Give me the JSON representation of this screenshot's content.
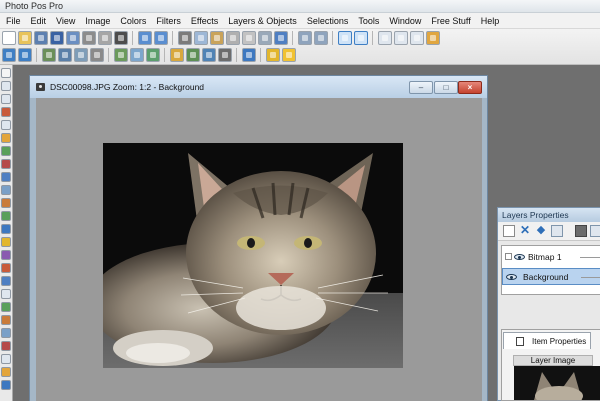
{
  "app": {
    "title": "Photo Pos Pro"
  },
  "menu": [
    "File",
    "Edit",
    "View",
    "Image",
    "Colors",
    "Filters",
    "Effects",
    "Layers & Objects",
    "Selections",
    "Tools",
    "Window",
    "Free Stuff",
    "Help"
  ],
  "document": {
    "title": "DSC00098.JPG  Zoom: 1:2 - Background"
  },
  "window_buttons": {
    "minimize": "–",
    "maximize": "□",
    "close": "×"
  },
  "layers_panel": {
    "title": "Layers Properties",
    "layers": [
      {
        "name": "Bitmap 1",
        "selected": false
      },
      {
        "name": "Background",
        "selected": true
      }
    ],
    "item_properties_tab": "Item Properties",
    "layer_image_label": "Layer Image"
  },
  "colors": {
    "accent": "#3f7fc4",
    "title_bar": "#c7d9ea",
    "workspace": "#6f6f6f",
    "canvas": "#9a9a9a"
  }
}
